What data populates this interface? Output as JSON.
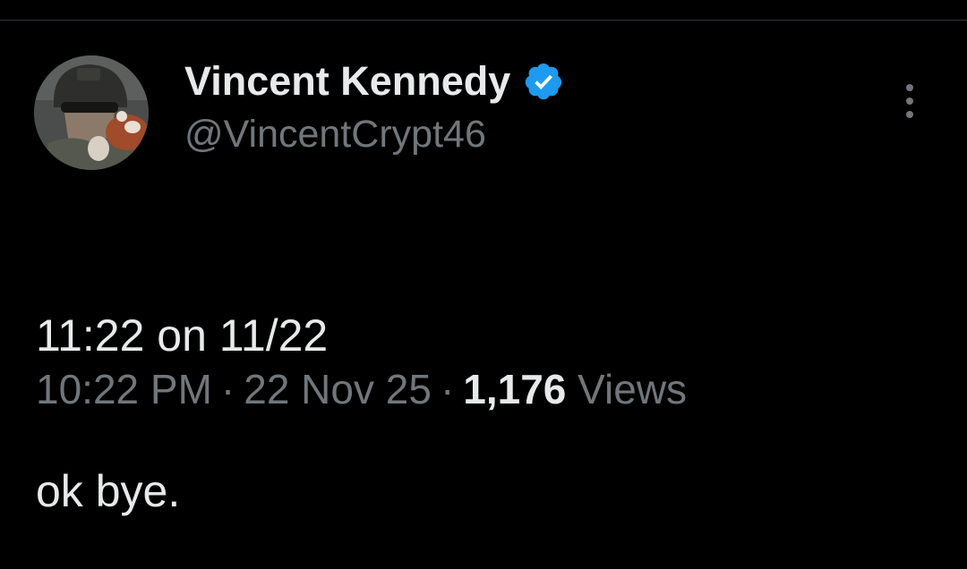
{
  "tweet": {
    "author": {
      "display_name": "Vincent Kennedy",
      "handle": "@VincentCrypt46",
      "verified": true,
      "verified_icon": "verified-badge-icon",
      "verified_color": "#1d9bf0"
    },
    "text_lines": [
      "11:22 on 11/22",
      "ok bye."
    ],
    "meta": {
      "time": "10:22 PM",
      "separator": "·",
      "date": "22 Nov 25",
      "views_count": "1,176",
      "views_label": "Views"
    },
    "more_icon": "more-vertical-icon"
  },
  "colors": {
    "background": "#000000",
    "text_primary": "#e7e9ea",
    "text_secondary": "#71767b",
    "divider": "#2f3336",
    "accent": "#1d9bf0"
  }
}
